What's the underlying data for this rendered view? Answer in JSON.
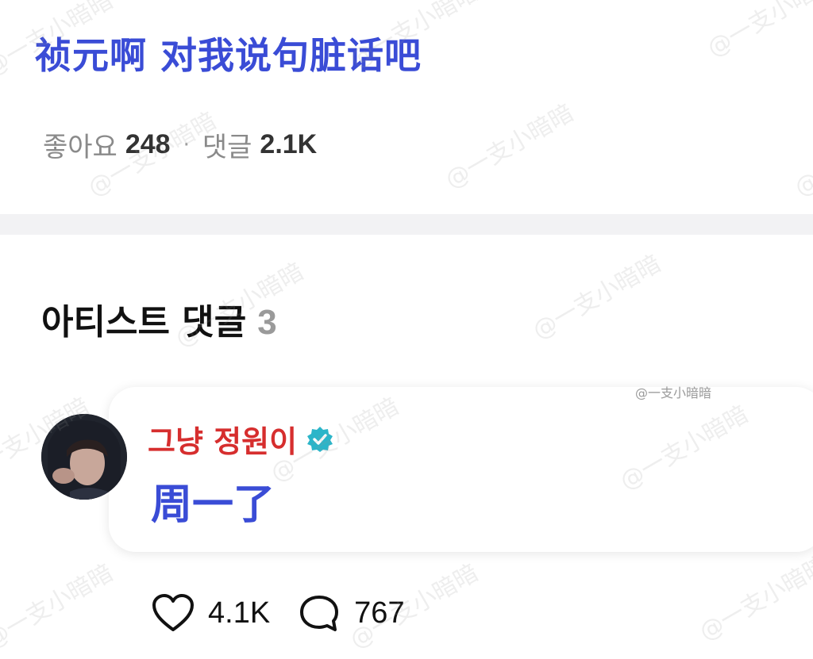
{
  "post": {
    "title": "祯元啊 对我说句脏话吧",
    "likes_label": "좋아요",
    "likes_count": "248",
    "separator": "·",
    "comments_label": "댓글",
    "comments_count": "2.1K"
  },
  "artist_comments": {
    "heading": "아티스트 댓글",
    "count": "3",
    "items": [
      {
        "author": "그냥 정원이",
        "text": "周一了",
        "likes": "4.1K",
        "replies": "767"
      }
    ]
  },
  "watermark": {
    "text": "@一支小暗暗",
    "small_text": "@一支小暗暗"
  },
  "colors": {
    "title_blue": "#3a4cd6",
    "author_red": "#d62e2e",
    "verified_teal": "#2bb5c9"
  },
  "icons": {
    "verified": "verified-badge-icon",
    "like": "heart-icon",
    "reply": "speech-bubble-icon"
  }
}
